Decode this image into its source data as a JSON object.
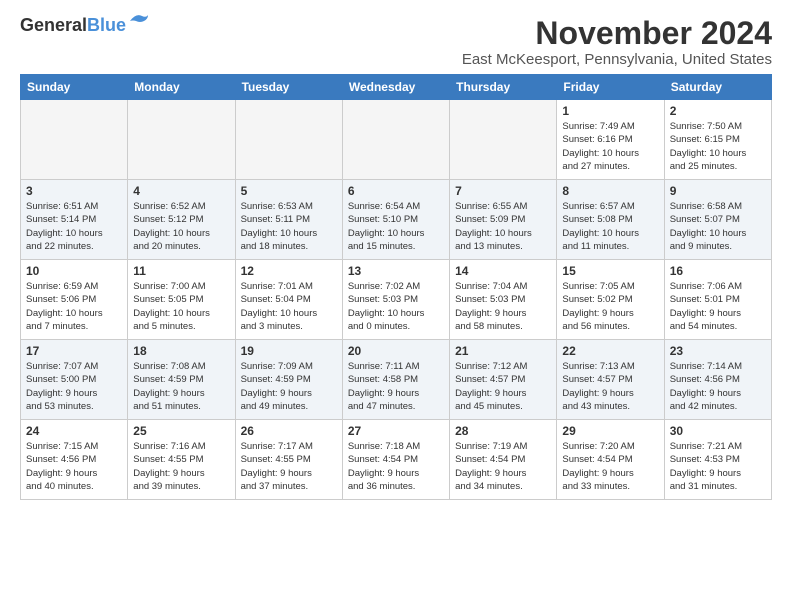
{
  "header": {
    "logo_general": "General",
    "logo_blue": "Blue",
    "month": "November 2024",
    "location": "East McKeesport, Pennsylvania, United States"
  },
  "days_of_week": [
    "Sunday",
    "Monday",
    "Tuesday",
    "Wednesday",
    "Thursday",
    "Friday",
    "Saturday"
  ],
  "weeks": [
    [
      {
        "day": "",
        "info": ""
      },
      {
        "day": "",
        "info": ""
      },
      {
        "day": "",
        "info": ""
      },
      {
        "day": "",
        "info": ""
      },
      {
        "day": "",
        "info": ""
      },
      {
        "day": "1",
        "info": "Sunrise: 7:49 AM\nSunset: 6:16 PM\nDaylight: 10 hours\nand 27 minutes."
      },
      {
        "day": "2",
        "info": "Sunrise: 7:50 AM\nSunset: 6:15 PM\nDaylight: 10 hours\nand 25 minutes."
      }
    ],
    [
      {
        "day": "3",
        "info": "Sunrise: 6:51 AM\nSunset: 5:14 PM\nDaylight: 10 hours\nand 22 minutes."
      },
      {
        "day": "4",
        "info": "Sunrise: 6:52 AM\nSunset: 5:12 PM\nDaylight: 10 hours\nand 20 minutes."
      },
      {
        "day": "5",
        "info": "Sunrise: 6:53 AM\nSunset: 5:11 PM\nDaylight: 10 hours\nand 18 minutes."
      },
      {
        "day": "6",
        "info": "Sunrise: 6:54 AM\nSunset: 5:10 PM\nDaylight: 10 hours\nand 15 minutes."
      },
      {
        "day": "7",
        "info": "Sunrise: 6:55 AM\nSunset: 5:09 PM\nDaylight: 10 hours\nand 13 minutes."
      },
      {
        "day": "8",
        "info": "Sunrise: 6:57 AM\nSunset: 5:08 PM\nDaylight: 10 hours\nand 11 minutes."
      },
      {
        "day": "9",
        "info": "Sunrise: 6:58 AM\nSunset: 5:07 PM\nDaylight: 10 hours\nand 9 minutes."
      }
    ],
    [
      {
        "day": "10",
        "info": "Sunrise: 6:59 AM\nSunset: 5:06 PM\nDaylight: 10 hours\nand 7 minutes."
      },
      {
        "day": "11",
        "info": "Sunrise: 7:00 AM\nSunset: 5:05 PM\nDaylight: 10 hours\nand 5 minutes."
      },
      {
        "day": "12",
        "info": "Sunrise: 7:01 AM\nSunset: 5:04 PM\nDaylight: 10 hours\nand 3 minutes."
      },
      {
        "day": "13",
        "info": "Sunrise: 7:02 AM\nSunset: 5:03 PM\nDaylight: 10 hours\nand 0 minutes."
      },
      {
        "day": "14",
        "info": "Sunrise: 7:04 AM\nSunset: 5:03 PM\nDaylight: 9 hours\nand 58 minutes."
      },
      {
        "day": "15",
        "info": "Sunrise: 7:05 AM\nSunset: 5:02 PM\nDaylight: 9 hours\nand 56 minutes."
      },
      {
        "day": "16",
        "info": "Sunrise: 7:06 AM\nSunset: 5:01 PM\nDaylight: 9 hours\nand 54 minutes."
      }
    ],
    [
      {
        "day": "17",
        "info": "Sunrise: 7:07 AM\nSunset: 5:00 PM\nDaylight: 9 hours\nand 53 minutes."
      },
      {
        "day": "18",
        "info": "Sunrise: 7:08 AM\nSunset: 4:59 PM\nDaylight: 9 hours\nand 51 minutes."
      },
      {
        "day": "19",
        "info": "Sunrise: 7:09 AM\nSunset: 4:59 PM\nDaylight: 9 hours\nand 49 minutes."
      },
      {
        "day": "20",
        "info": "Sunrise: 7:11 AM\nSunset: 4:58 PM\nDaylight: 9 hours\nand 47 minutes."
      },
      {
        "day": "21",
        "info": "Sunrise: 7:12 AM\nSunset: 4:57 PM\nDaylight: 9 hours\nand 45 minutes."
      },
      {
        "day": "22",
        "info": "Sunrise: 7:13 AM\nSunset: 4:57 PM\nDaylight: 9 hours\nand 43 minutes."
      },
      {
        "day": "23",
        "info": "Sunrise: 7:14 AM\nSunset: 4:56 PM\nDaylight: 9 hours\nand 42 minutes."
      }
    ],
    [
      {
        "day": "24",
        "info": "Sunrise: 7:15 AM\nSunset: 4:56 PM\nDaylight: 9 hours\nand 40 minutes."
      },
      {
        "day": "25",
        "info": "Sunrise: 7:16 AM\nSunset: 4:55 PM\nDaylight: 9 hours\nand 39 minutes."
      },
      {
        "day": "26",
        "info": "Sunrise: 7:17 AM\nSunset: 4:55 PM\nDaylight: 9 hours\nand 37 minutes."
      },
      {
        "day": "27",
        "info": "Sunrise: 7:18 AM\nSunset: 4:54 PM\nDaylight: 9 hours\nand 36 minutes."
      },
      {
        "day": "28",
        "info": "Sunrise: 7:19 AM\nSunset: 4:54 PM\nDaylight: 9 hours\nand 34 minutes."
      },
      {
        "day": "29",
        "info": "Sunrise: 7:20 AM\nSunset: 4:54 PM\nDaylight: 9 hours\nand 33 minutes."
      },
      {
        "day": "30",
        "info": "Sunrise: 7:21 AM\nSunset: 4:53 PM\nDaylight: 9 hours\nand 31 minutes."
      }
    ]
  ]
}
